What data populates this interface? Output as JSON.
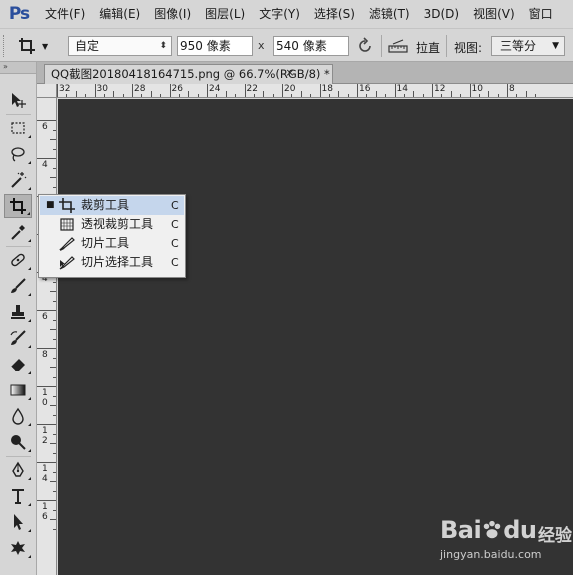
{
  "app": {
    "logo": "Ps"
  },
  "menu": [
    "文件(F)",
    "编辑(E)",
    "图像(I)",
    "图层(L)",
    "文字(Y)",
    "选择(S)",
    "滤镜(T)",
    "3D(D)",
    "视图(V)",
    "窗口"
  ],
  "options": {
    "ratio_value": "自定",
    "width_value": "950 像素",
    "x_label": "x",
    "height_value": "540 像素",
    "straighten_label": "拉直",
    "view_label": "视图:",
    "view_value": "三等分"
  },
  "toolbox": {
    "header": "»",
    "tools": [
      "move-tool",
      "marquee-tool",
      "lasso-tool",
      "magic-wand-tool",
      "crop-tool",
      "eyedropper-tool",
      "healing-brush-tool",
      "brush-tool",
      "clone-stamp-tool",
      "history-brush-tool",
      "eraser-tool",
      "gradient-tool",
      "blur-tool",
      "dodge-tool",
      "pen-tool",
      "type-tool",
      "path-selection-tool",
      "custom-shape-tool"
    ],
    "active": "crop-tool"
  },
  "document": {
    "tab_title": "QQ截图20180418164715.png @ 66.7%(RGB/8) *",
    "close_glyph": "×"
  },
  "ruler_h": [
    "32",
    "30",
    "28",
    "26",
    "24",
    "22",
    "20",
    "18",
    "16",
    "14",
    "12",
    "10",
    "8"
  ],
  "ruler_v": [
    "6",
    "4",
    "2",
    "2",
    "4",
    "6",
    "8",
    "10",
    "12",
    "14",
    "16"
  ],
  "flyout": [
    {
      "label": "裁剪工具",
      "key": "C",
      "bullet": "■",
      "selected": true,
      "icon": "crop-icon"
    },
    {
      "label": "透视裁剪工具",
      "key": "C",
      "bullet": "",
      "selected": false,
      "icon": "perspective-crop-icon"
    },
    {
      "label": "切片工具",
      "key": "C",
      "bullet": "",
      "selected": false,
      "icon": "slice-icon"
    },
    {
      "label": "切片选择工具",
      "key": "C",
      "bullet": "",
      "selected": false,
      "icon": "slice-select-icon"
    }
  ],
  "watermark": {
    "brand": "Bai",
    "brand2": "du",
    "cn": "经验",
    "url": "jingyan.baidu.com"
  },
  "colors": {
    "canvas": "#333333",
    "chrome": "#d6d6d6",
    "accent": "#2a4e9c",
    "flyout_selected": "#c5d6ec"
  }
}
